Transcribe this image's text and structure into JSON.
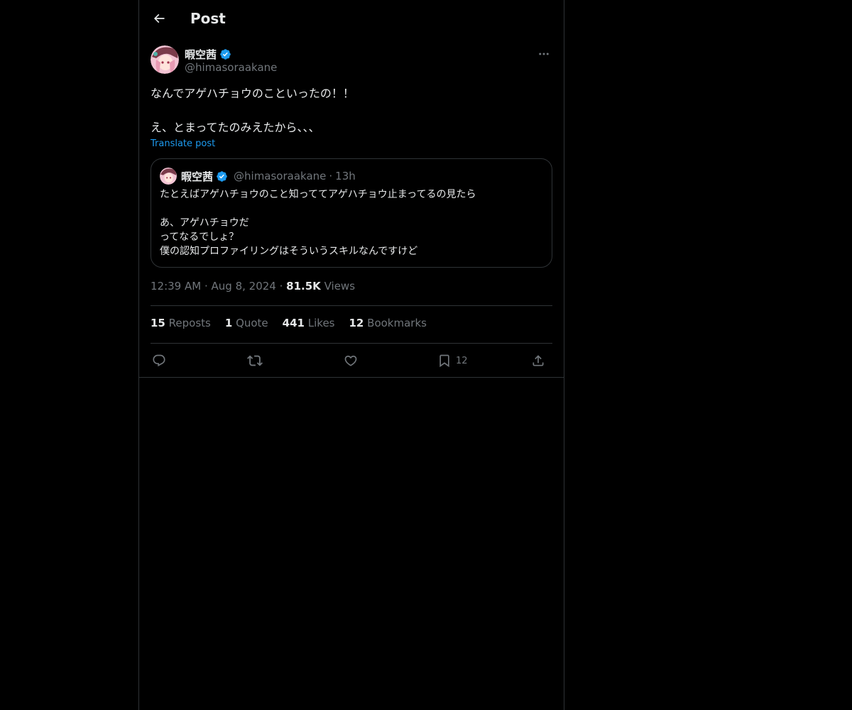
{
  "header": {
    "title": "Post"
  },
  "post": {
    "author_name": "暇空茜",
    "author_handle": "@himasoraakane",
    "text_lines": [
      "なんでアゲハチョウのこといったの！！",
      "え、とまってたのみえたから、、、"
    ],
    "translate_label": "Translate post",
    "time": "12:39 AM",
    "date": "Aug 8, 2024",
    "views_count": "81.5K",
    "views_label": "Views"
  },
  "quote": {
    "author_name": "暇空茜",
    "author_handle": "@himasoraakane",
    "separator": "·",
    "time": "13h",
    "lines": [
      "たとえばアゲハチョウのこと知っててアゲハチョウ止まってるの見たら",
      "",
      "あ、アゲハチョウだ",
      "ってなるでしょ？",
      "僕の認知プロファイリングはそういうスキルなんですけど"
    ]
  },
  "stats": {
    "reposts_count": "15",
    "reposts_label": "Reposts",
    "quotes_count": "1",
    "quotes_label": "Quote",
    "likes_count": "441",
    "likes_label": "Likes",
    "bookmarks_count": "12",
    "bookmarks_label": "Bookmarks"
  },
  "actions": {
    "bookmark_count": "12"
  },
  "icons": {
    "back": "arrow-left-icon",
    "verified": "verified-badge-icon",
    "more": "more-horizontal-icon",
    "reply": "reply-icon",
    "repost": "repost-icon",
    "like": "heart-icon",
    "bookmark": "bookmark-icon",
    "share": "share-icon"
  },
  "colors": {
    "background": "#000000",
    "accent": "#1d9bf0",
    "text_primary": "#e7e9ea",
    "text_secondary": "#71767b",
    "border": "#2f3336"
  }
}
